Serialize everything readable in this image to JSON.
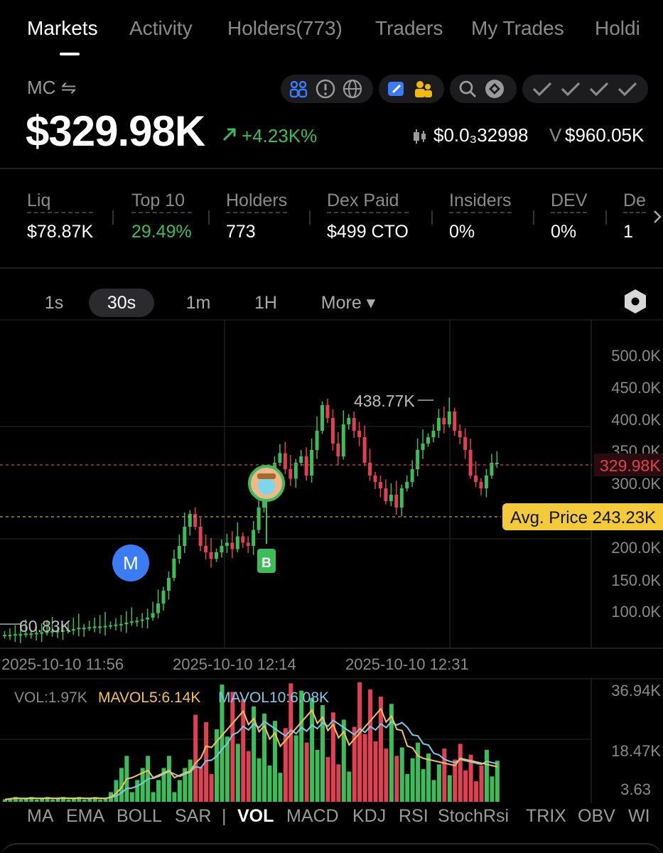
{
  "tabs": [
    {
      "label": "Markets"
    },
    {
      "label": "Activity"
    },
    {
      "label": "Holders(773)"
    },
    {
      "label": "Traders"
    },
    {
      "label": "My Trades"
    },
    {
      "label": "Holdi"
    }
  ],
  "header": {
    "mc_label": "MC ⇋",
    "mc_value": "$329.98K",
    "mc_change": "+4.23K%",
    "price": "$0.0₃32998",
    "volume_prefix": "V",
    "volume": "$960.05K"
  },
  "icons": {
    "group1": [
      "users-icon",
      "alert-icon",
      "globe-icon"
    ],
    "group2": [
      "edit-icon",
      "people-icon"
    ],
    "group3": [
      "search-icon",
      "bnb-icon"
    ],
    "group4": [
      "check-icon",
      "check-icon",
      "check-icon",
      "check-icon"
    ],
    "accent_blue": "#3b7bf6",
    "accent_yellow": "#f0b90b"
  },
  "stats": [
    {
      "label": "Liq",
      "value": "$78.87K",
      "color": "#ffffff"
    },
    {
      "label": "Top 10",
      "value": "29.49%",
      "color": "#3dbd5a"
    },
    {
      "label": "Holders",
      "value": "773",
      "color": "#ffffff"
    },
    {
      "label": "Dex Paid",
      "value": "$499 CTO",
      "color": "#ffffff"
    },
    {
      "label": "Insiders",
      "value": "0%",
      "color": "#ffffff"
    },
    {
      "label": "DEV",
      "value": "0%",
      "color": "#ffffff"
    },
    {
      "label": "De",
      "value": "1",
      "color": "#ffffff"
    }
  ],
  "intervals": [
    {
      "label": "1s",
      "active": false
    },
    {
      "label": "30s",
      "active": true
    },
    {
      "label": "1m",
      "active": false
    },
    {
      "label": "1H",
      "active": false
    },
    {
      "label": "More ▾",
      "active": false
    }
  ],
  "chart_data": {
    "type": "candlestick",
    "y_ticks": [
      "500.0K",
      "450.0K",
      "400.0K",
      "350.0K",
      "300.0K",
      "200.0K",
      "150.0K",
      "100.0K"
    ],
    "x_ticks": [
      "2025-10-10 11:56",
      "2025-10-10 12:14",
      "2025-10-10 12:31"
    ],
    "current_price_label": "329.98K",
    "current_price": 329.98,
    "avg_price_label": "Avg. Price 243.23K",
    "avg_price": 243.23,
    "high_label": "438.77K",
    "high": 438.77,
    "low_label": "60.83K",
    "low": 60.83,
    "markers": [
      "M",
      "B"
    ],
    "up_color": "#3dbd5a",
    "down_color": "#e04152"
  },
  "volume": {
    "vol_label": "VOL:1.97K",
    "mavol5_label": "MAVOL5:6.14K",
    "mavol10_label": "MAVOL10:6.08K",
    "y_ticks": [
      "36.94K",
      "18.47K",
      "3.63"
    ],
    "mavol5_color": "#f5c156",
    "mavol10_color": "#7cc8e8"
  },
  "indicators": [
    {
      "label": "MA",
      "active": false
    },
    {
      "label": "EMA",
      "active": false
    },
    {
      "label": "BOLL",
      "active": false
    },
    {
      "label": "SAR",
      "active": false
    },
    {
      "label": "|",
      "active": false
    },
    {
      "label": "VOL",
      "active": true
    },
    {
      "label": "MACD",
      "active": false
    },
    {
      "label": "KDJ",
      "active": false
    },
    {
      "label": "RSI",
      "active": false
    },
    {
      "label": "StochRsi",
      "active": false
    },
    {
      "label": "TRIX",
      "active": false
    },
    {
      "label": "OBV",
      "active": false
    },
    {
      "label": "WI",
      "active": false
    }
  ]
}
